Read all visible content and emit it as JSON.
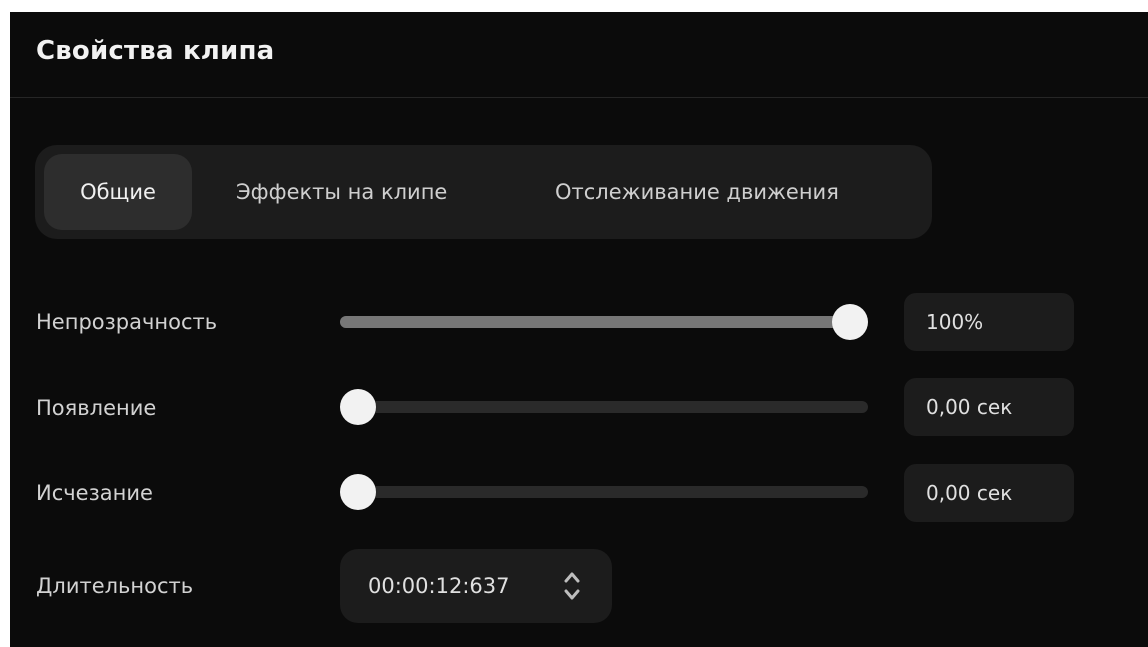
{
  "panel": {
    "title": "Свойства клипа"
  },
  "tabs": [
    {
      "label": "Общие",
      "active": true
    },
    {
      "label": "Эффекты на клипе",
      "active": false
    },
    {
      "label": "Отслеживание движения",
      "active": false
    }
  ],
  "properties": {
    "opacity": {
      "label": "Непрозрачность",
      "value": "100%",
      "level": 1.0
    },
    "fade_in": {
      "label": "Появление",
      "value": "0,00 сек",
      "level": 0.0
    },
    "fade_out": {
      "label": "Исчезание",
      "value": "0,00 сек",
      "level": 0.0
    },
    "duration": {
      "label": "Длительность",
      "value": "00:00:12:637",
      "icon": "spinner-updown-icon"
    }
  },
  "colors": {
    "background": "#0b0b0b",
    "control_bg": "#1c1c1c",
    "slider_fill": "#777777",
    "slider_thumb": "#f2f2f2"
  }
}
